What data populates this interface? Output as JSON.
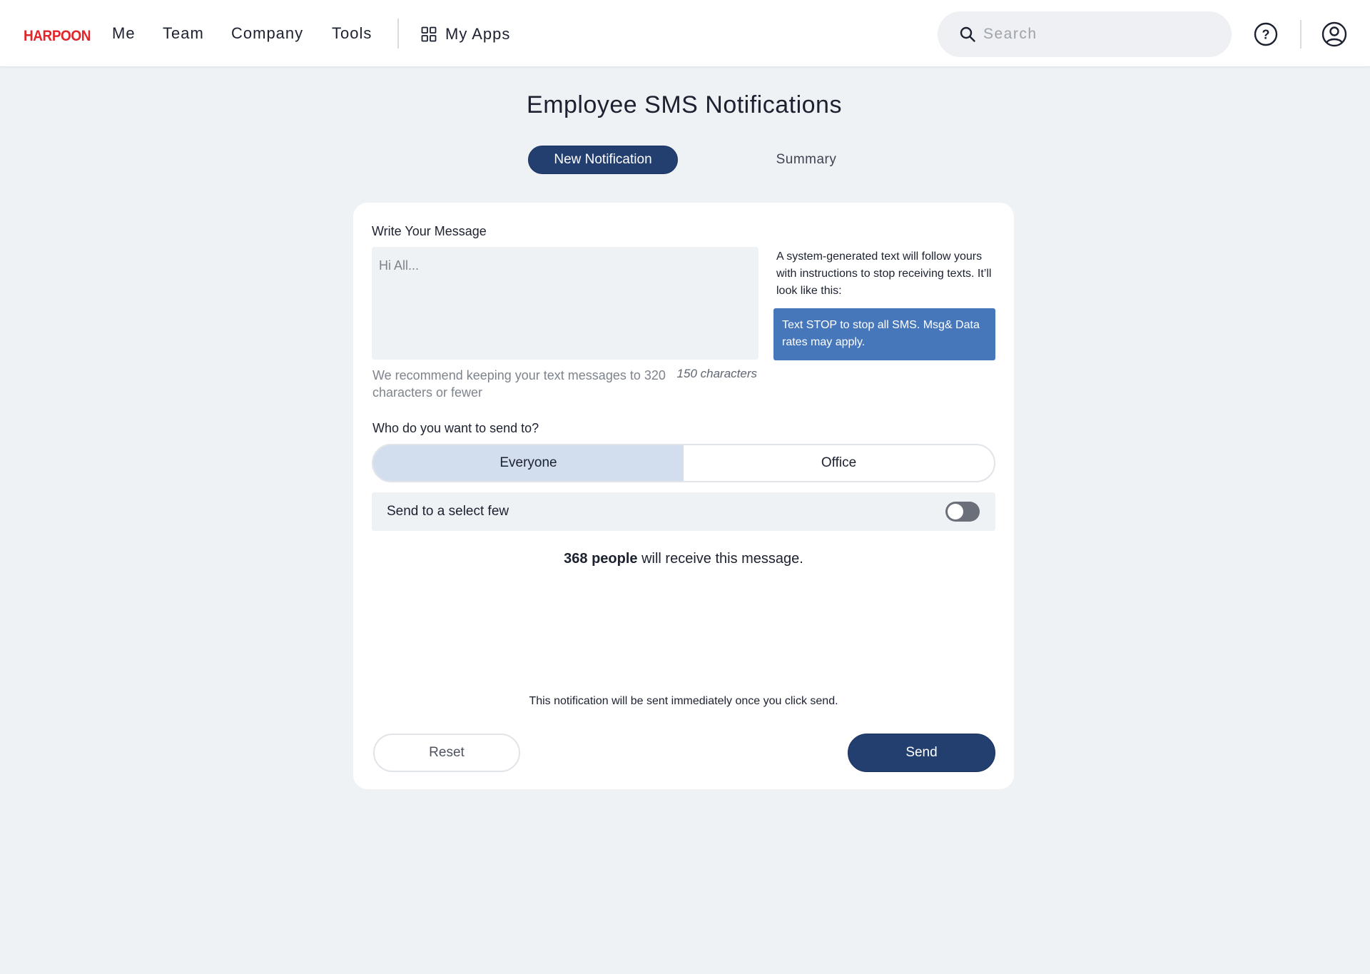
{
  "header": {
    "logo_text": "HARPOON",
    "nav": [
      "Me",
      "Team",
      "Company",
      "Tools"
    ],
    "my_apps_label": "My Apps",
    "search": {
      "placeholder": "Search",
      "value": ""
    }
  },
  "page": {
    "title": "Employee SMS Notifications",
    "tabs": [
      {
        "label": "New Notification",
        "active": true
      },
      {
        "label": "Summary",
        "active": false
      }
    ]
  },
  "form": {
    "message_heading": "Write Your Message",
    "message_placeholder": "Hi All...",
    "message_value": "",
    "hint": "We recommend keeping your text messages to 320 characters or fewer",
    "char_count": "150 characters",
    "system_note": "A system-generated text will follow yours with instructions to stop receiving texts. It’ll look like this:",
    "stop_preview": "Text STOP to stop all SMS. Msg& Data rates may apply.",
    "recipient_question": "Who do you want to send to?",
    "recipient_options": [
      {
        "label": "Everyone",
        "selected": true
      },
      {
        "label": "Office",
        "selected": false
      }
    ],
    "select_few_label": "Send to a select few",
    "select_few_enabled": false,
    "recipient_count": "368 people",
    "recipient_suffix": " will receive this message.",
    "send_note": "This notification will be sent immediately once you click send.",
    "reset_label": "Reset",
    "send_label": "Send"
  },
  "colors": {
    "brand_red": "#e0252b",
    "primary_navy": "#233f70",
    "preview_blue": "#4677bb",
    "segment_selected": "#d2ddee",
    "page_bg": "#eff2f5"
  },
  "icons": [
    "grid-icon",
    "search-icon",
    "help-icon",
    "user-icon"
  ]
}
